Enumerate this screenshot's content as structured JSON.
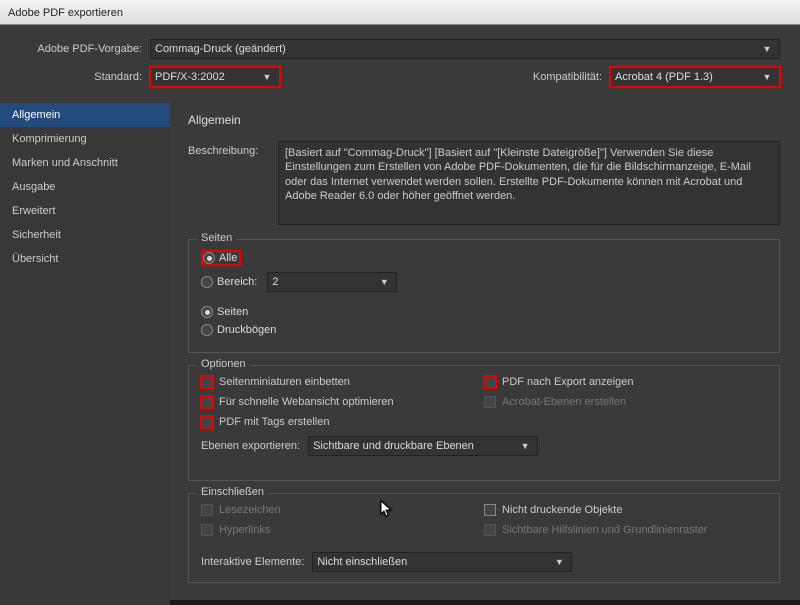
{
  "window": {
    "title": "Adobe PDF exportieren"
  },
  "topbar": {
    "preset_label": "Adobe PDF-Vorgabe:",
    "preset_value": "Commag-Druck (geändert)",
    "standard_label": "Standard:",
    "standard_value": "PDF/X-3:2002",
    "compat_label": "Kompatibilität:",
    "compat_value": "Acrobat 4 (PDF 1.3)"
  },
  "sidebar": {
    "items": [
      {
        "label": "Allgemein",
        "active": true
      },
      {
        "label": "Komprimierung",
        "active": false
      },
      {
        "label": "Marken und Anschnitt",
        "active": false
      },
      {
        "label": "Ausgabe",
        "active": false
      },
      {
        "label": "Erweitert",
        "active": false
      },
      {
        "label": "Sicherheit",
        "active": false
      },
      {
        "label": "Übersicht",
        "active": false
      }
    ]
  },
  "content": {
    "heading": "Allgemein",
    "description_label": "Beschreibung:",
    "description_text": "[Basiert auf \"Commag-Druck\"] [Basiert auf \"[Kleinste Dateigröße]\"] Verwenden Sie diese Einstellungen zum Erstellen von Adobe PDF-Dokumenten, die für die Bildschirmanzeige, E-Mail oder das Internet verwendet werden sollen. Erstellte PDF-Dokumente können mit Acrobat und Adobe Reader 6.0 oder höher geöffnet werden.",
    "pages": {
      "legend": "Seiten",
      "all": "Alle",
      "range": "Bereich:",
      "range_value": "2",
      "pages_label": "Seiten",
      "spreads": "Druckbögen"
    },
    "options": {
      "legend": "Optionen",
      "embed_thumbs": "Seitenminiaturen einbetten",
      "fast_web": "Für schnelle Webansicht optimieren",
      "tagged_pdf": "PDF mit Tags erstellen",
      "view_after": "PDF nach Export anzeigen",
      "acrobat_layers": "Acrobat-Ebenen erstellen",
      "export_layers_label": "Ebenen exportieren:",
      "export_layers_value": "Sichtbare und druckbare Ebenen"
    },
    "include": {
      "legend": "Einschließen",
      "bookmarks": "Lesezeichen",
      "hyperlinks": "Hyperlinks",
      "nonprinting": "Nicht druckende Objekte",
      "guides": "Sichtbare Hilfslinien und Grundlinienraster",
      "interactive_label": "Interaktive Elemente:",
      "interactive_value": "Nicht einschließen"
    }
  }
}
